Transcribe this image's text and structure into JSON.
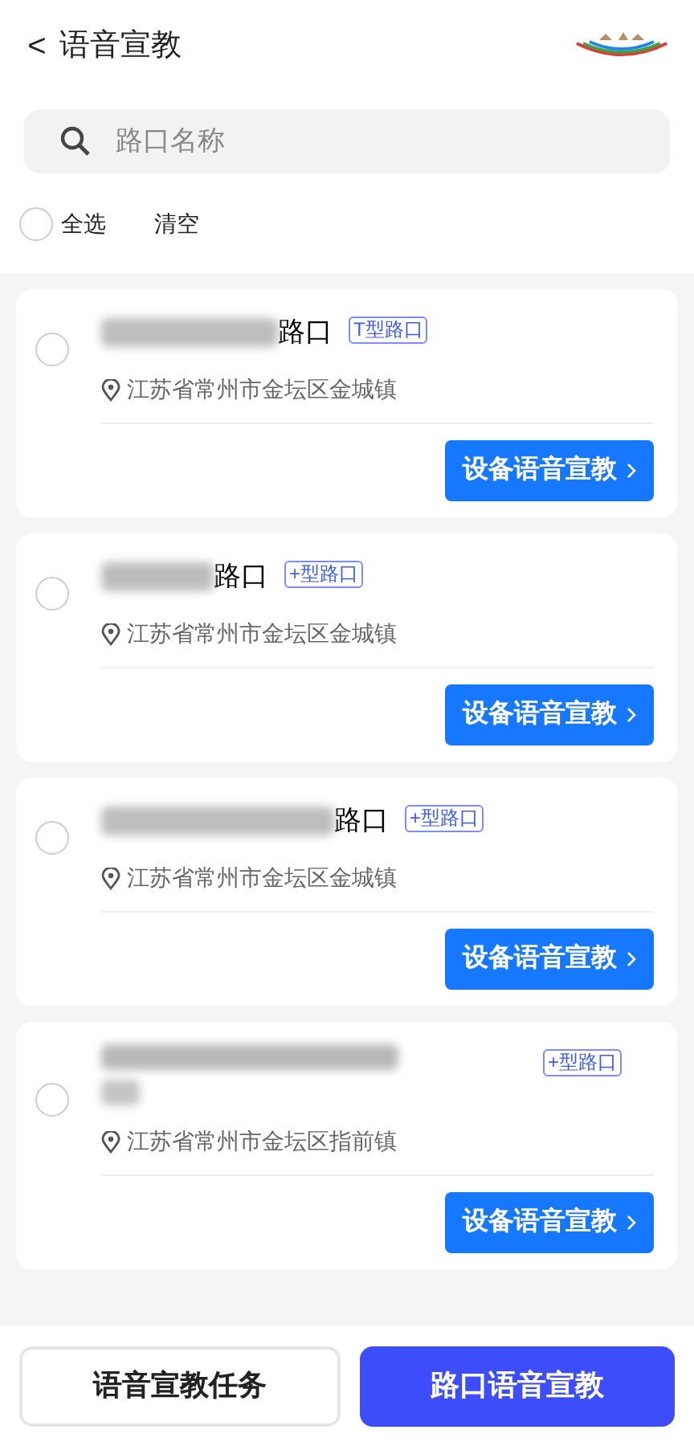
{
  "header": {
    "back_icon": "<",
    "title": "语音宣教"
  },
  "search": {
    "placeholder": "路口名称"
  },
  "select_bar": {
    "select_all": {
      "label": "全选",
      "checked": false
    },
    "clear": "清空"
  },
  "intersections": [
    {
      "redacted": true,
      "name": "路口",
      "tag": "T型路口",
      "address": "江苏省常州市金坛区金城镇",
      "selected": false,
      "action": "设备语音宣教"
    },
    {
      "redacted": true,
      "name": "路口",
      "tag": "+型路口",
      "address": "江苏省常州市金坛区金城镇",
      "selected": false,
      "action": "设备语音宣教"
    },
    {
      "redacted": true,
      "name": "路口",
      "tag": "+型路口",
      "address": "江苏省常州市金坛区金城镇",
      "selected": false,
      "action": "设备语音宣教"
    },
    {
      "redacted": true,
      "tag": "+型路口",
      "address": "江苏省常州市金坛区指前镇",
      "selected": false,
      "action": "设备语音宣教"
    }
  ],
  "bottom_buttons": [
    {
      "label": "语音宣教任务",
      "kind": "secondary"
    },
    {
      "label": "路口语音宣教",
      "kind": "primary"
    }
  ]
}
